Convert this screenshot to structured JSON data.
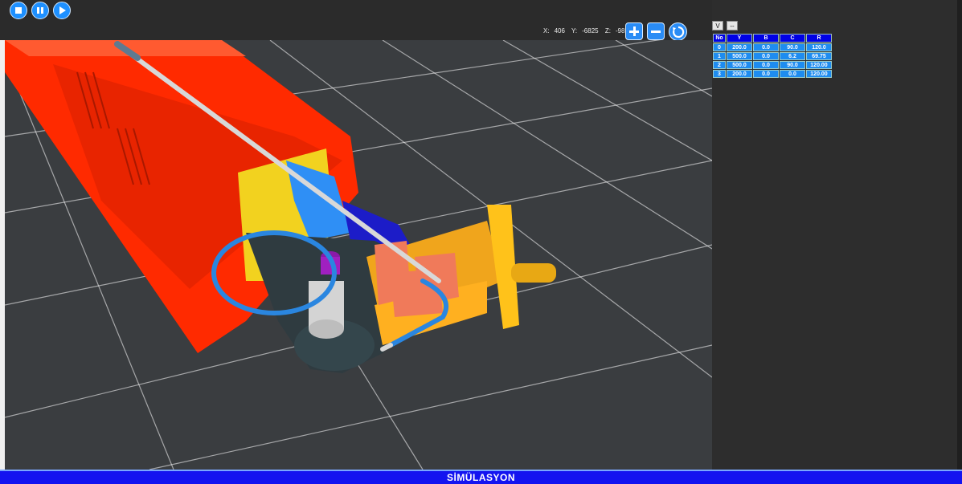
{
  "toolbar": {
    "stop_icon": "stop-icon",
    "pause_icon": "pause-icon",
    "play_icon": "play-icon"
  },
  "coords": {
    "x_label": "X:",
    "x_value": "406",
    "y_label": "Y:",
    "y_value": "-6825",
    "z_label": "Z:",
    "z_value": "-982"
  },
  "view_controls": {
    "zoom_in_icon": "plus-icon",
    "zoom_out_icon": "minus-icon",
    "reset_icon": "rotate-icon"
  },
  "panel": {
    "btn_v": "V",
    "btn_dash": "--"
  },
  "table": {
    "headers": [
      "No",
      "Y",
      "B",
      "C",
      "R"
    ],
    "rows": [
      [
        "0",
        "200.0",
        "0.0",
        "90.0",
        "120.0"
      ],
      [
        "1",
        "500.0",
        "0.0",
        "6.2",
        "69.75"
      ],
      [
        "2",
        "500.0",
        "0.0",
        "90.0",
        "120.00"
      ],
      [
        "3",
        "200.0",
        "0.0",
        "0.0",
        "120.00"
      ]
    ]
  },
  "footer": {
    "title": "SİMÜLASYON"
  },
  "colors": {
    "machine_body": "#ff2a00",
    "bend_head": "#ffc107",
    "tube": "#1e7fd6",
    "accent_button": "#1e90ff",
    "status_bar": "#1414f0"
  }
}
